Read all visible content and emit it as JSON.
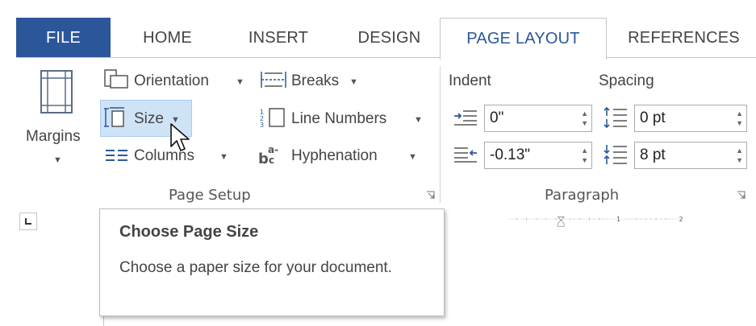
{
  "tabs": {
    "file": "FILE",
    "home": "HOME",
    "insert": "INSERT",
    "design": "DESIGN",
    "page_layout": "PAGE LAYOUT",
    "references": "REFERENCES"
  },
  "page_setup": {
    "margins": "Margins",
    "orientation": "Orientation",
    "size": "Size",
    "columns": "Columns",
    "breaks": "Breaks",
    "line_numbers": "Line Numbers",
    "hyphenation": "Hyphenation",
    "group_title": "Page Setup"
  },
  "paragraph": {
    "indent_label": "Indent",
    "spacing_label": "Spacing",
    "indent_left": "0\"",
    "indent_right": "-0.13\"",
    "spacing_before": "0 pt",
    "spacing_after": "8 pt",
    "group_title": "Paragraph"
  },
  "ruler": {
    "marks": [
      "1",
      "2"
    ]
  },
  "tooltip": {
    "title": "Choose Page Size",
    "description": "Choose a paper size for your document."
  },
  "colors": {
    "file_tab": "#2b579a",
    "active_tab_text": "#2b579a",
    "highlight": "#cfe3f7"
  }
}
